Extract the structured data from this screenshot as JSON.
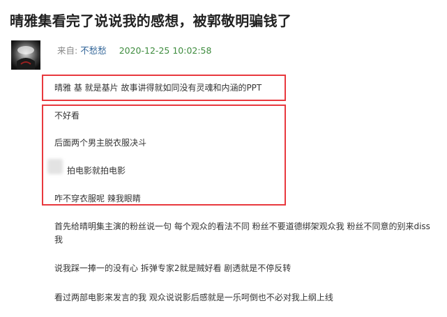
{
  "post": {
    "title": "晴雅集看完了说说我的感想，被郭敬明骗钱了",
    "from_label": "来自: ",
    "author": "不愁愁",
    "timestamp": "2020-12-25 10:02:58"
  },
  "content": {
    "boxed_line": "晴雅 基  就是基片 故事讲得就如同没有灵魂和内涵的PPT",
    "boxed_group": [
      "不好看",
      "后面两个男主脱衣服决斗",
      "拍电影就拍电影",
      "咋不穿衣服呢 辣我眼睛"
    ],
    "paragraphs": [
      "首先给晴明集主演的粉丝说一句 每个观众的看法不同 粉丝不要道德绑架观众我 粉丝不同意的别来diss我",
      "说我踩一捧一的没有心 拆弹专家2就是贼好看 剧透就是不停反转",
      "看过两部电影来发言的我 观众说说影后感就是一乐呵倒也不必对我上纲上线"
    ]
  },
  "colors": {
    "highlight_border": "#e8383d",
    "author_link": "#336699",
    "timestamp": "#3d8b3d"
  },
  "icons": {
    "avatar": "avatar-image"
  }
}
